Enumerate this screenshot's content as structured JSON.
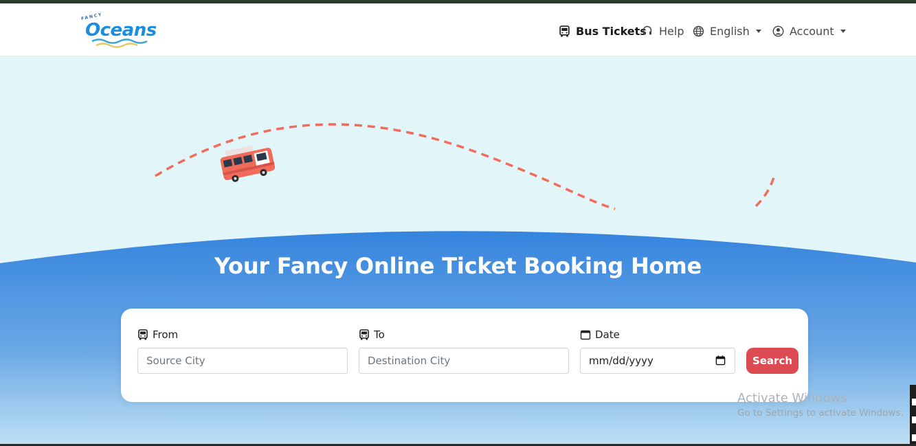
{
  "brand": {
    "logo_small": "FANCY",
    "logo_text": "Oceans"
  },
  "nav": {
    "bus_tickets": "Bus Tickets",
    "help": "Help",
    "language": "English",
    "account": "Account"
  },
  "hero": {
    "headline": "Your Fancy Online Ticket Booking Home"
  },
  "search": {
    "from_label": "From",
    "from_placeholder": "Source City",
    "to_label": "To",
    "to_placeholder": "Destination City",
    "date_label": "Date",
    "date_placeholder": "mm/dd/yyyy",
    "button_label": "Search"
  },
  "system": {
    "watermark_title": "Activate Windows",
    "watermark_subtitle": "Go to Settings to activate Windows."
  },
  "colors": {
    "accent_red": "#dc4a52",
    "sky": "#e2f5f8",
    "blue_top": "#3584de",
    "blue_bottom": "#b8dcf3",
    "path_dash": "#f26b5b"
  },
  "icons": {
    "bus": "bus-icon",
    "help": "headset-icon",
    "language": "globe-icon",
    "account": "user-circle-icon",
    "date": "calendar-icon"
  }
}
